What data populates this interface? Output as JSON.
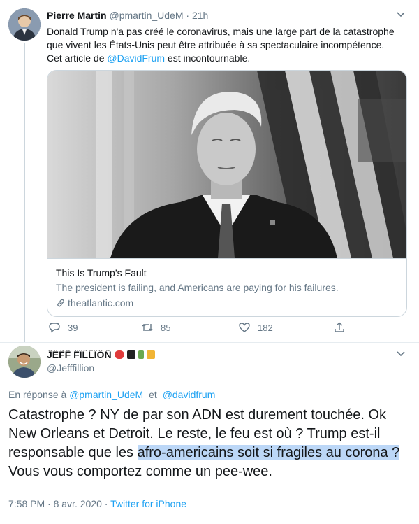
{
  "tweet": {
    "author_name": "Pierre Martin",
    "author_handle": "@pmartin_UdeM",
    "separator": "·",
    "time": "21h",
    "text_part1": "Donald Trump n'a pas créé le coronavirus, mais une large part de la catastrophe que vivent les États-Unis peut être attribuée à sa spectaculaire incompétence. Cet article de ",
    "mention": "@DavidFrum",
    "text_part2": " est incontournable.",
    "card": {
      "title": "This Is Trump’s Fault",
      "description": "The president is failing, and Americans are paying for his failures.",
      "domain": "theatlantic.com"
    },
    "actions": {
      "replies": "39",
      "retweets": "85",
      "likes": "182"
    }
  },
  "reply_tweet": {
    "author_name": "J̈ËF̈F̈ F̈ÏL̈L̈ÏÖN̈",
    "author_handle": "@Jefffillion",
    "replying_to_label": "En réponse à",
    "replying_to_user1": "@pmartin_UdeM",
    "replying_to_and": "et",
    "replying_to_user2": "@davidfrum",
    "text_part1": "Catastrophe ? NY de par son ADN est durement touchée. Ok New Orleans et Detroit. Le reste, le feu est où ? Trump est-il responsable que les ",
    "text_highlighted": "afro-americains soit si fragiles au corona ?",
    "text_part2": " Vous vous comportez comme un pee-wee.",
    "time": "7:58 PM",
    "separator": "·",
    "date": "8 avr. 2020",
    "separator2": "·",
    "source": "Twitter for iPhone"
  },
  "colors": {
    "link": "#1da1f2",
    "muted": "#657786",
    "text": "#14171a",
    "highlight": "#bcd7f7",
    "border": "#ccd6dd"
  }
}
